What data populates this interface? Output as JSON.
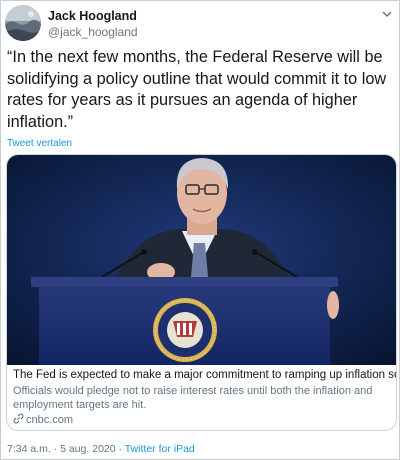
{
  "author": {
    "name": "Jack Hoogland",
    "handle": "@jack_hoogland"
  },
  "tweet": {
    "text": "“In the next few months, the Federal Reserve will be solidifying a policy outline that would commit it to low rates for years as it pursues an agenda of higher inflation.”",
    "translate_label": "Tweet vertalen"
  },
  "card": {
    "image_alt": "Jerome Powell speaking at a podium with the Federal Reserve seal",
    "title": "The Fed is expected to make a major commitment to ramping up inflation soon",
    "description": "Officials would pledge not to raise interest rates until both the inflation and employment targets are hit.",
    "domain": "cnbc.com",
    "link_icon": "link-icon"
  },
  "meta": {
    "time": "7:34 a.m.",
    "separator1": " · ",
    "date": "5 aug. 2020",
    "separator2": " · ",
    "source": "Twitter for iPad"
  },
  "icons": {
    "caret": "chevron-down-icon"
  },
  "colors": {
    "link": "#1b95e0",
    "secondary": "#657786",
    "photo_background": "#0d1f4a",
    "podium": "#1d2f6e"
  }
}
